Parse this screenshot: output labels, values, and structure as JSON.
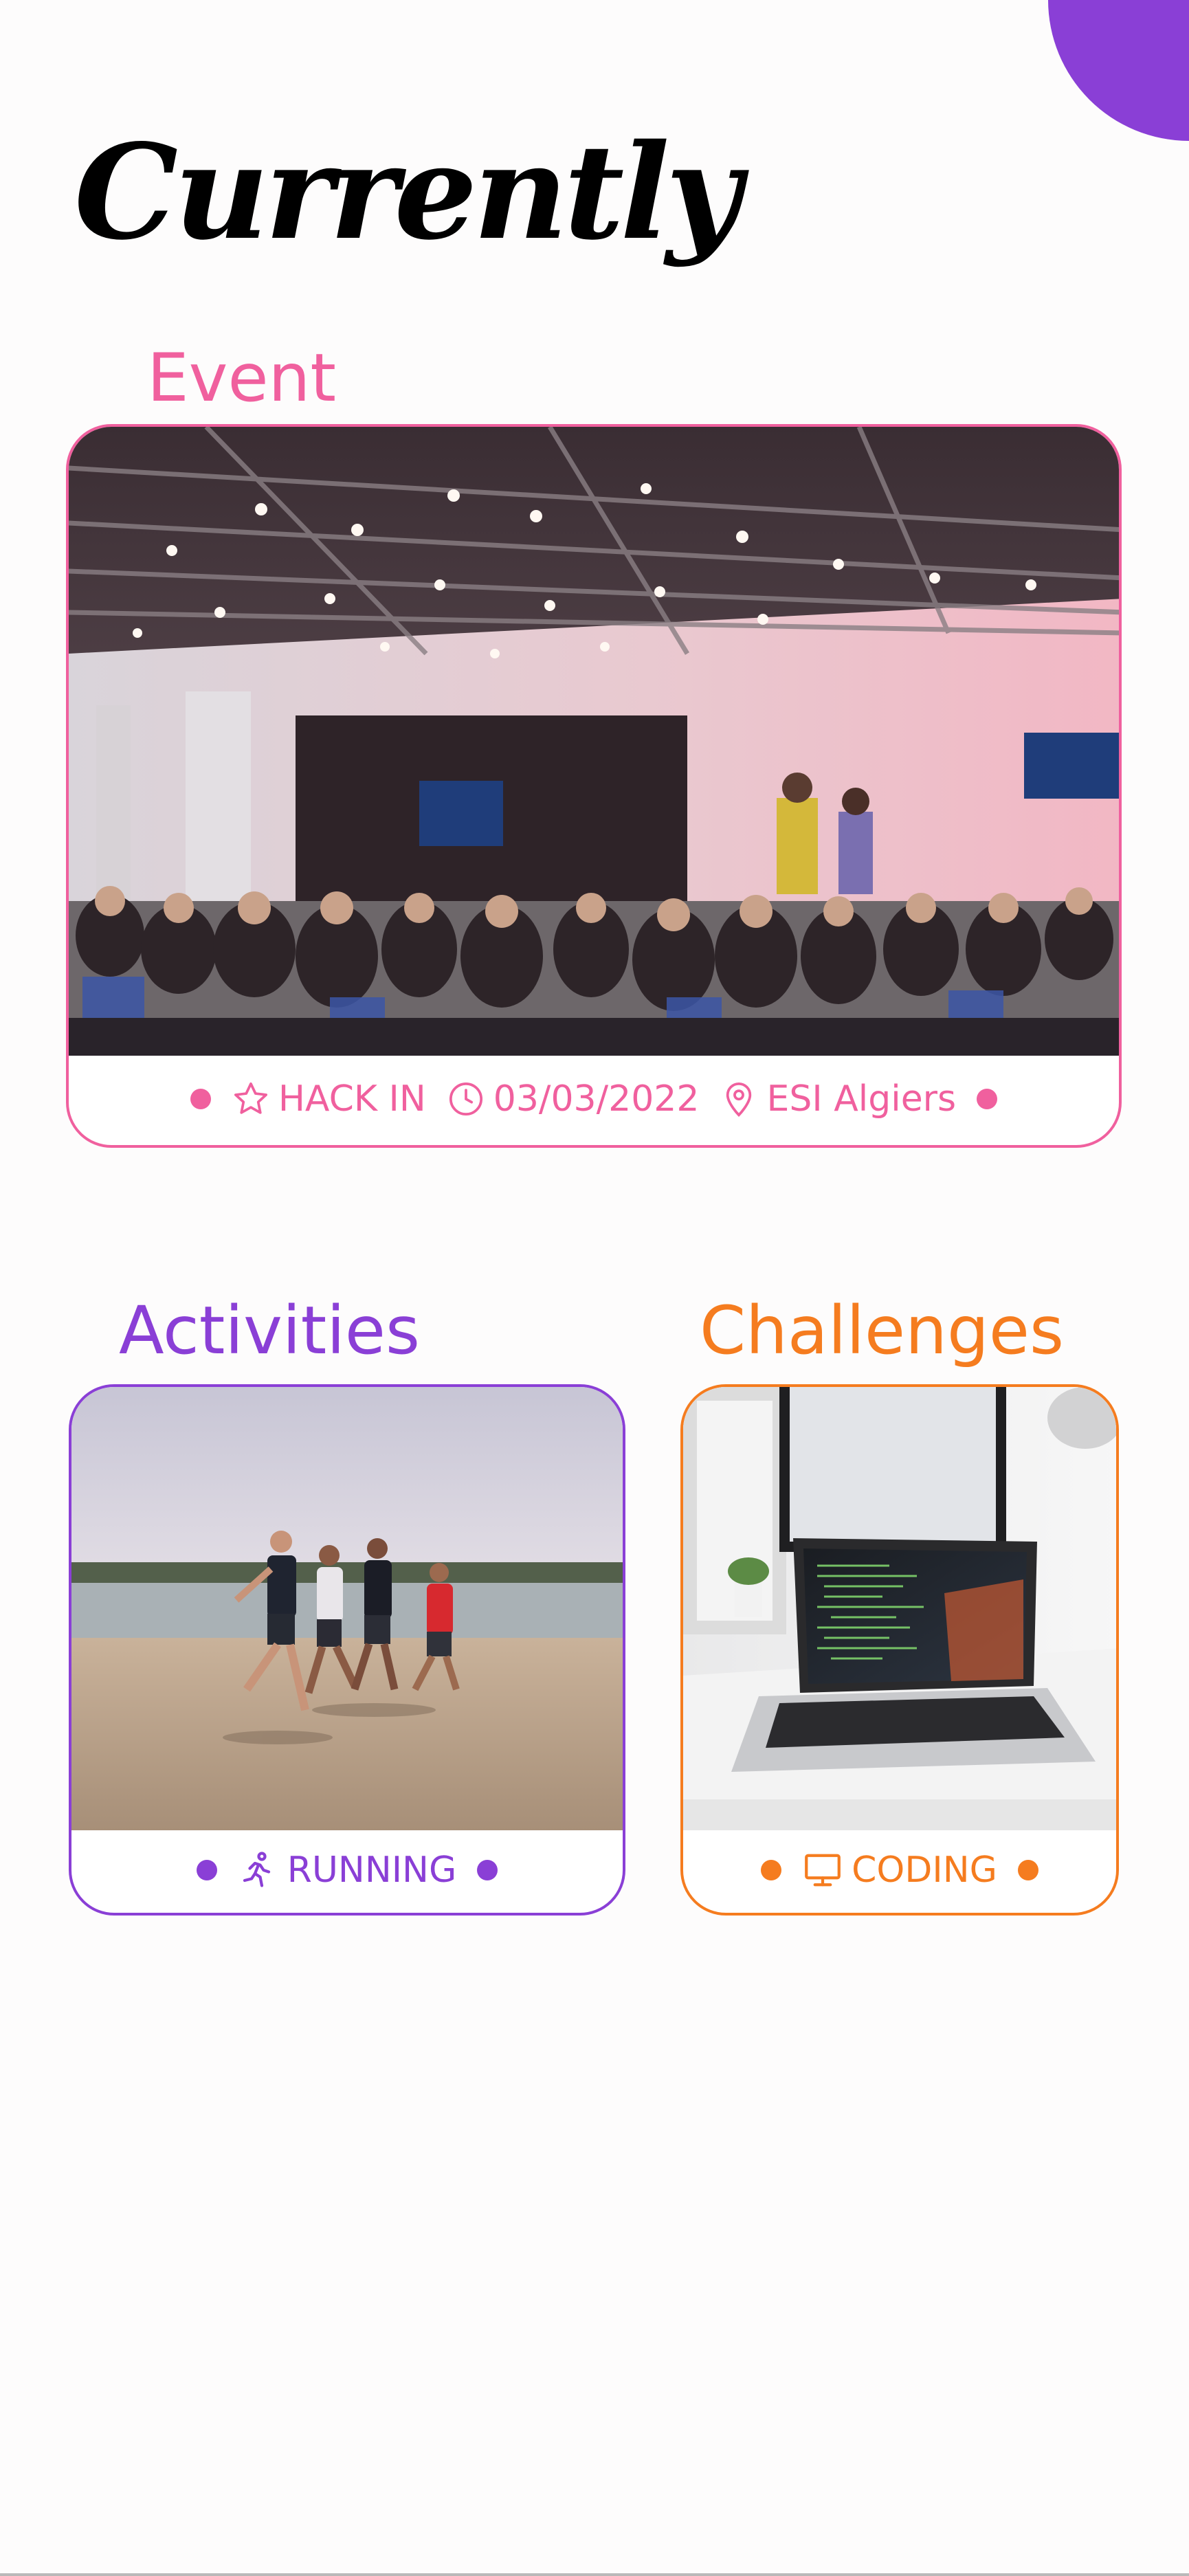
{
  "title": "Currently",
  "colors": {
    "event": "#f0609e",
    "activities": "#8a3fd6",
    "challenges": "#f57c1f",
    "corner": "#8a3fd6"
  },
  "event": {
    "heading": "Event",
    "name": "HACK IN",
    "date": "03/03/2022",
    "location": "ESI Algiers",
    "icons": [
      "star-icon",
      "clock-icon",
      "map-pin-icon"
    ]
  },
  "activities": {
    "heading": "Activities",
    "label": "RUNNING",
    "icon": "running-person-icon"
  },
  "challenges": {
    "heading": "Challenges",
    "label": "CODING",
    "icon": "monitor-icon"
  }
}
